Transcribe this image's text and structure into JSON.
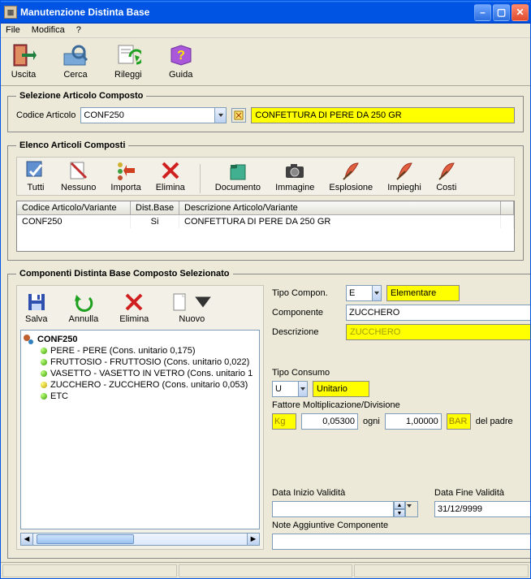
{
  "window": {
    "title": "Manutenzione Distinta Base"
  },
  "menu": {
    "file": "File",
    "modifica": "Modifica",
    "help": "?"
  },
  "maintb": {
    "uscita": "Uscita",
    "cerca": "Cerca",
    "rileggi": "Rileggi",
    "guida": "Guida"
  },
  "sel": {
    "legend": "Selezione Articolo Composto",
    "codice_lbl": "Codice Articolo",
    "codice_val": "CONF250",
    "desc": "CONFETTURA DI PERE DA 250 GR"
  },
  "elenco": {
    "legend": "Elenco Articoli Composti",
    "tb": {
      "tutti": "Tutti",
      "nessuno": "Nessuno",
      "importa": "Importa",
      "elimina": "Elimina",
      "documento": "Documento",
      "immagine": "Immagine",
      "esplosione": "Esplosione",
      "impieghi": "Impieghi",
      "costi": "Costi"
    },
    "cols": {
      "c1": "Codice Articolo/Variante",
      "c2": "Dist.Base",
      "c3": "Descrizione Articolo/Variante"
    },
    "row": {
      "codice": "CONF250",
      "dist": "Si",
      "desc": "CONFETTURA DI PERE DA 250 GR"
    }
  },
  "comp": {
    "legend": "Componenti Distinta Base Composto Selezionato",
    "tb": {
      "salva": "Salva",
      "annulla": "Annulla",
      "elimina": "Elimina",
      "nuovo": "Nuovo"
    },
    "tree_root": "CONF250",
    "tree_items": [
      "PERE - PERE (Cons. unitario 0,175)",
      "FRUTTOSIO - FRUTTOSIO (Cons. unitario 0,022)",
      "VASETTO - VASETTO IN VETRO (Cons. unitario 1",
      "ZUCCHERO - ZUCCHERO (Cons. unitario 0,053)",
      "ETC"
    ],
    "form": {
      "tipo_compon_lbl": "Tipo Compon.",
      "tipo_compon_val": "E",
      "tipo_compon_desc": "Elementare",
      "componente_lbl": "Componente",
      "componente_val": "ZUCCHERO",
      "descrizione_lbl": "Descrizione",
      "descrizione_val": "ZUCCHERO",
      "tipo_consumo_lbl": "Tipo Consumo",
      "tipo_consumo_val": "U",
      "tipo_consumo_desc": "Unitario",
      "fattore_lbl": "Fattore Moltiplicazione/Divisione",
      "um1": "Kg",
      "val1": "0,05300",
      "ogni": "ogni",
      "val2": "1,00000",
      "um2": "BAR",
      "delpadre": "del padre",
      "data_inizio_lbl": "Data Inizio Validità",
      "data_inizio_val": "",
      "data_fine_lbl": "Data Fine Validità",
      "data_fine_val": "31/12/9999",
      "note_lbl": "Note Aggiuntive Componente",
      "note_val": ""
    }
  }
}
